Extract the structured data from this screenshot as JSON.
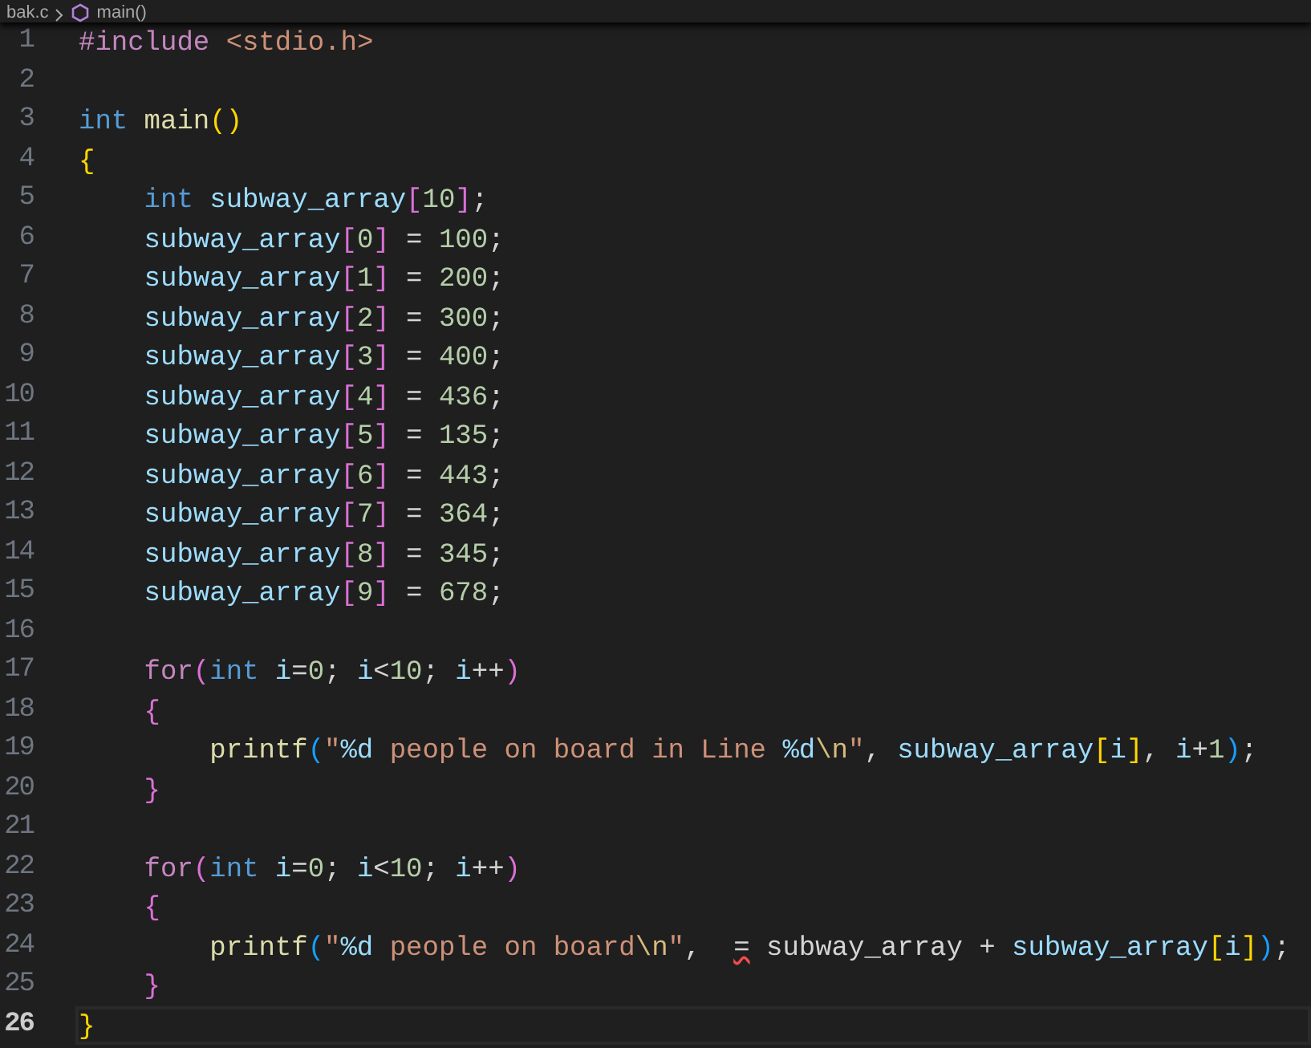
{
  "breadcrumb": {
    "file": "bak.c",
    "symbol": "main()"
  },
  "lines": [
    {
      "number": "1",
      "current": false,
      "tokens": [
        {
          "kind": "pre",
          "text": "#include"
        },
        {
          "kind": "inc",
          "text": " <stdio.h>"
        }
      ]
    },
    {
      "number": "2",
      "current": false
    },
    {
      "number": "3",
      "current": false,
      "tokens": [
        {
          "kind": "kw",
          "text": "int"
        },
        {
          "kind": "fn",
          "text": " main"
        },
        {
          "kind": "b1",
          "text": "()"
        }
      ]
    },
    {
      "number": "4",
      "current": false,
      "tokens": [
        {
          "kind": "b1",
          "text": "{"
        }
      ]
    },
    {
      "number": "5",
      "current": false,
      "tokens": [
        {
          "kind": "kw",
          "text": "    int"
        },
        {
          "kind": "var",
          "text": " subway_array"
        },
        {
          "kind": "b2",
          "text": "["
        },
        {
          "kind": "num",
          "text": "10"
        },
        {
          "kind": "b2",
          "text": "]"
        },
        {
          "kind": "punct",
          "text": ";"
        }
      ]
    },
    {
      "number": "6",
      "current": false,
      "tokens": [
        {
          "kind": "var",
          "text": "    subway_array"
        },
        {
          "kind": "b2",
          "text": "["
        },
        {
          "kind": "num",
          "text": "0"
        },
        {
          "kind": "b2",
          "text": "]"
        },
        {
          "kind": "punct",
          "text": " = "
        },
        {
          "kind": "num",
          "text": "100"
        },
        {
          "kind": "punct",
          "text": ";"
        }
      ]
    },
    {
      "number": "7",
      "current": false,
      "tokens": [
        {
          "kind": "var",
          "text": "    subway_array"
        },
        {
          "kind": "b2",
          "text": "["
        },
        {
          "kind": "num",
          "text": "1"
        },
        {
          "kind": "b2",
          "text": "]"
        },
        {
          "kind": "punct",
          "text": " = "
        },
        {
          "kind": "num",
          "text": "200"
        },
        {
          "kind": "punct",
          "text": ";"
        }
      ]
    },
    {
      "number": "8",
      "current": false,
      "tokens": [
        {
          "kind": "var",
          "text": "    subway_array"
        },
        {
          "kind": "b2",
          "text": "["
        },
        {
          "kind": "num",
          "text": "2"
        },
        {
          "kind": "b2",
          "text": "]"
        },
        {
          "kind": "punct",
          "text": " = "
        },
        {
          "kind": "num",
          "text": "300"
        },
        {
          "kind": "punct",
          "text": ";"
        }
      ]
    },
    {
      "number": "9",
      "current": false,
      "tokens": [
        {
          "kind": "var",
          "text": "    subway_array"
        },
        {
          "kind": "b2",
          "text": "["
        },
        {
          "kind": "num",
          "text": "3"
        },
        {
          "kind": "b2",
          "text": "]"
        },
        {
          "kind": "punct",
          "text": " = "
        },
        {
          "kind": "num",
          "text": "400"
        },
        {
          "kind": "punct",
          "text": ";"
        }
      ]
    },
    {
      "number": "10",
      "current": false,
      "tokens": [
        {
          "kind": "var",
          "text": "    subway_array"
        },
        {
          "kind": "b2",
          "text": "["
        },
        {
          "kind": "num",
          "text": "4"
        },
        {
          "kind": "b2",
          "text": "]"
        },
        {
          "kind": "punct",
          "text": " = "
        },
        {
          "kind": "num",
          "text": "436"
        },
        {
          "kind": "punct",
          "text": ";"
        }
      ]
    },
    {
      "number": "11",
      "current": false,
      "tokens": [
        {
          "kind": "var",
          "text": "    subway_array"
        },
        {
          "kind": "b2",
          "text": "["
        },
        {
          "kind": "num",
          "text": "5"
        },
        {
          "kind": "b2",
          "text": "]"
        },
        {
          "kind": "punct",
          "text": " = "
        },
        {
          "kind": "num",
          "text": "135"
        },
        {
          "kind": "punct",
          "text": ";"
        }
      ]
    },
    {
      "number": "12",
      "current": false,
      "tokens": [
        {
          "kind": "var",
          "text": "    subway_array"
        },
        {
          "kind": "b2",
          "text": "["
        },
        {
          "kind": "num",
          "text": "6"
        },
        {
          "kind": "b2",
          "text": "]"
        },
        {
          "kind": "punct",
          "text": " = "
        },
        {
          "kind": "num",
          "text": "443"
        },
        {
          "kind": "punct",
          "text": ";"
        }
      ]
    },
    {
      "number": "13",
      "current": false,
      "tokens": [
        {
          "kind": "var",
          "text": "    subway_array"
        },
        {
          "kind": "b2",
          "text": "["
        },
        {
          "kind": "num",
          "text": "7"
        },
        {
          "kind": "b2",
          "text": "]"
        },
        {
          "kind": "punct",
          "text": " = "
        },
        {
          "kind": "num",
          "text": "364"
        },
        {
          "kind": "punct",
          "text": ";"
        }
      ]
    },
    {
      "number": "14",
      "current": false,
      "tokens": [
        {
          "kind": "var",
          "text": "    subway_array"
        },
        {
          "kind": "b2",
          "text": "["
        },
        {
          "kind": "num",
          "text": "8"
        },
        {
          "kind": "b2",
          "text": "]"
        },
        {
          "kind": "punct",
          "text": " = "
        },
        {
          "kind": "num",
          "text": "345"
        },
        {
          "kind": "punct",
          "text": ";"
        }
      ]
    },
    {
      "number": "15",
      "current": false,
      "tokens": [
        {
          "kind": "var",
          "text": "    subway_array"
        },
        {
          "kind": "b2",
          "text": "["
        },
        {
          "kind": "num",
          "text": "9"
        },
        {
          "kind": "b2",
          "text": "]"
        },
        {
          "kind": "punct",
          "text": " = "
        },
        {
          "kind": "num",
          "text": "678"
        },
        {
          "kind": "punct",
          "text": ";"
        }
      ]
    },
    {
      "number": "16",
      "current": false
    },
    {
      "number": "17",
      "current": false,
      "tokens": [
        {
          "kind": "ctl",
          "text": "    for"
        },
        {
          "kind": "b2",
          "text": "("
        },
        {
          "kind": "kw",
          "text": "int"
        },
        {
          "kind": "var",
          "text": " i"
        },
        {
          "kind": "punct",
          "text": "="
        },
        {
          "kind": "num",
          "text": "0"
        },
        {
          "kind": "punct",
          "text": ";"
        },
        {
          "kind": "var",
          "text": " i"
        },
        {
          "kind": "punct",
          "text": "<"
        },
        {
          "kind": "num",
          "text": "10"
        },
        {
          "kind": "punct",
          "text": ";"
        },
        {
          "kind": "var",
          "text": " i"
        },
        {
          "kind": "punct",
          "text": "++"
        },
        {
          "kind": "b2",
          "text": ")"
        }
      ]
    },
    {
      "number": "18",
      "current": false,
      "tokens": [
        {
          "kind": "b2",
          "text": "    {"
        }
      ]
    },
    {
      "number": "19",
      "current": false,
      "tokens": [
        {
          "kind": "fn",
          "text": "        printf"
        },
        {
          "kind": "b3",
          "text": "("
        },
        {
          "kind": "str",
          "text": "\""
        },
        {
          "kind": "esc",
          "text": "%d"
        },
        {
          "kind": "str",
          "text": " people on board in Line "
        },
        {
          "kind": "esc",
          "text": "%d"
        },
        {
          "kind": "esc2",
          "text": "\\n"
        },
        {
          "kind": "str",
          "text": "\""
        },
        {
          "kind": "punct",
          "text": ","
        },
        {
          "kind": "var",
          "text": " subway_array"
        },
        {
          "kind": "b1",
          "text": "["
        },
        {
          "kind": "var",
          "text": "i"
        },
        {
          "kind": "b1",
          "text": "]"
        },
        {
          "kind": "punct",
          "text": ","
        },
        {
          "kind": "var",
          "text": " i"
        },
        {
          "kind": "punct",
          "text": "+"
        },
        {
          "kind": "num",
          "text": "1"
        },
        {
          "kind": "b3",
          "text": ")"
        },
        {
          "kind": "punct",
          "text": ";"
        }
      ]
    },
    {
      "number": "20",
      "current": false,
      "tokens": [
        {
          "kind": "b2",
          "text": "    }"
        }
      ]
    },
    {
      "number": "21",
      "current": false
    },
    {
      "number": "22",
      "current": false,
      "tokens": [
        {
          "kind": "ctl",
          "text": "    for"
        },
        {
          "kind": "b2",
          "text": "("
        },
        {
          "kind": "kw",
          "text": "int"
        },
        {
          "kind": "var",
          "text": " i"
        },
        {
          "kind": "punct",
          "text": "="
        },
        {
          "kind": "num",
          "text": "0"
        },
        {
          "kind": "punct",
          "text": ";"
        },
        {
          "kind": "var",
          "text": " i"
        },
        {
          "kind": "punct",
          "text": "<"
        },
        {
          "kind": "num",
          "text": "10"
        },
        {
          "kind": "punct",
          "text": ";"
        },
        {
          "kind": "var",
          "text": " i"
        },
        {
          "kind": "punct",
          "text": "++"
        },
        {
          "kind": "b2",
          "text": ")"
        }
      ]
    },
    {
      "number": "23",
      "current": false,
      "tokens": [
        {
          "kind": "b2",
          "text": "    {"
        }
      ]
    },
    {
      "number": "24",
      "current": false,
      "tokens": [
        {
          "kind": "fn",
          "text": "        printf"
        },
        {
          "kind": "b3",
          "text": "("
        },
        {
          "kind": "str",
          "text": "\""
        },
        {
          "kind": "esc",
          "text": "%d"
        },
        {
          "kind": "str",
          "text": " people on board"
        },
        {
          "kind": "esc2",
          "text": "\\n"
        },
        {
          "kind": "str",
          "text": "\""
        },
        {
          "kind": "punct",
          "text": ",  "
        },
        {
          "kind": "err",
          "text": "="
        },
        {
          "kind": "punct",
          "text": " subway_array +"
        },
        {
          "kind": "var",
          "text": " subway_array"
        },
        {
          "kind": "b1",
          "text": "["
        },
        {
          "kind": "var",
          "text": "i"
        },
        {
          "kind": "b1",
          "text": "]"
        },
        {
          "kind": "b3",
          "text": ")"
        },
        {
          "kind": "punct",
          "text": ";"
        }
      ]
    },
    {
      "number": "25",
      "current": false,
      "tokens": [
        {
          "kind": "b2",
          "text": "    }"
        }
      ]
    },
    {
      "number": "26",
      "current": true,
      "tokens": [
        {
          "kind": "b1",
          "text": "}"
        }
      ]
    }
  ]
}
